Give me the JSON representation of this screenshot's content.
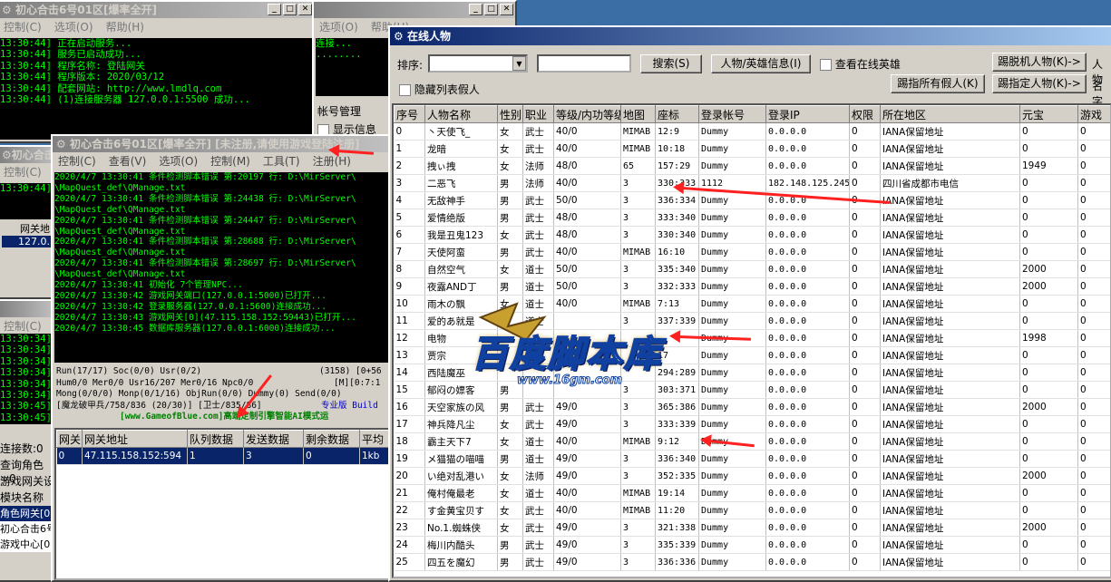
{
  "desk_color": "#3a6ea5",
  "win_login": {
    "title": "初心合击6号01区[爆率全开]",
    "menu": [
      "控制(C)",
      "选项(O)",
      "帮助(H)"
    ],
    "log": [
      "13:30:44] 正在启动服务...",
      "13:30:44] 服务已启动成功...",
      "13:30:44] 程序名称: 登陆网关",
      "13:30:44] 程序版本: 2020/03/12",
      "13:30:44] 配套网站: http://www.lmdlq.com",
      "13:30:44] (1)连接服务器 127.0.0.1:5500 成功..."
    ]
  },
  "win_mid": {
    "menu": [
      "选项(O)",
      "帮助(H)"
    ],
    "log": [
      "连接...",
      "........"
    ],
    "label_account": "帐号管理",
    "check_show": "显示信息"
  },
  "win_left": {
    "title": "初心合击6",
    "menu": [
      "控制(C)",
      "选"
    ],
    "log": [
      "13:30:44]"
    ],
    "col": "网关地",
    "ip": "127.0."
  },
  "win_left2": {
    "menu": "控制(C)",
    "log": [
      "13:30:34]",
      "13:30:34]",
      "13:30:34]",
      "13:30:34]",
      "13:30:34]",
      "13:30:34]",
      "13:30:45]",
      "13:30:45]"
    ],
    "conn": "连接数:0",
    "query": "查询角色=0",
    "gateset": "游戏网关设",
    "modname": "模块名称",
    "mods": [
      "角色网关[0",
      "初心合击6号",
      "游戏中心[0"
    ]
  },
  "win_main": {
    "title": "初心合击6号01区[爆率全开] [未注册,请使用游戏登陆注册]",
    "menu": [
      "控制(C)",
      "查看(V)",
      "选项(O)",
      "控制(M)",
      "工具(T)",
      "注册(H)"
    ],
    "log": [
      "2020/4/7 13:30:41 条件检测脚本错误 第:20197 行: D:\\MirServer\\",
      "\\MapQuest_def\\QManage.txt",
      "2020/4/7 13:30:41 条件检测脚本错误 第:24438 行: D:\\MirServer\\",
      "\\MapQuest_def\\QManage.txt",
      "2020/4/7 13:30:41 条件检测脚本错误 第:24447 行: D:\\MirServer\\",
      "\\MapQuest_def\\QManage.txt",
      "2020/4/7 13:30:41 条件检测脚本错误 第:28688 行: D:\\MirServer\\",
      "\\MapQuest_def\\QManage.txt",
      "2020/4/7 13:30:41 条件检测脚本错误 第:28697 行: D:\\MirServer\\",
      "\\MapQuest_def\\QManage.txt",
      "2020/4/7 13:30:41 初始化 7个管理NPC...",
      "2020/4/7 13:30:42 游戏网关端口(127.0.0.1:5000)已打开...",
      "2020/4/7 13:30:42 登录服务器(127.0.0.1:5600)连接成功...",
      "2020/4/7 13:30:43 游戏网关[0](47.115.158.152:59443)已打开...",
      "2020/4/7 13:30:45 数据库服务器(127.0.0.1:6000)连接成功..."
    ],
    "stat1": "Run(17/17) Soc(0/0) Usr(0/2)",
    "stat1r": "(3158) [0+56",
    "stat2": "Hum0/0 Mer0/0 Usr16/207 Mer0/16 Npc0/0",
    "stat2r": "[M][0:7:1",
    "stat3": "Mong(0/0/0) Monp(0/1/16) ObjRun(0/0) Dummy(0) Send(0/0)",
    "stat4": "[魔龙破甲兵/758/836 (20/30)]  [卫士/835/86]",
    "stat4r": "专业版 Build",
    "banner": "[www.GameofBlue.com]高端定制引擎智能AI模式运",
    "gate_cols": [
      "网关",
      "网关地址",
      "队列数据",
      "发送数据",
      "剩余数据",
      "平均"
    ],
    "gate_row": [
      "0",
      "47.115.158.152:594",
      "1",
      "3",
      "0",
      "1kb"
    ]
  },
  "online": {
    "title": "在线人物",
    "sort_label": "排序:",
    "btn_search": "搜索(S)",
    "btn_info": "人物/英雄信息(I)",
    "chk_hero": "查看在线英雄",
    "btn_kick_off": "踢脱机人物(K)->",
    "btn_person": "人物",
    "chk_hide": "隐藏列表假人",
    "btn_kick_all": "踢指所有假人(K)",
    "btn_kick_sel": "踢指定人物(K)->",
    "btn_name": "名字",
    "cols": [
      "序号",
      "人物名称",
      "性别",
      "职业",
      "等级/内功等级",
      "地图",
      "座标",
      "登录帐号",
      "登录IP",
      "权限",
      "所在地区",
      "元宝",
      "游戏"
    ],
    "rows": [
      [
        "0",
        "丶天使飞_",
        "女",
        "武士",
        "40/0",
        "MIMAB",
        "12:9",
        "Dummy",
        "0.0.0.0",
        "0",
        "IANA保留地址",
        "0",
        "0"
      ],
      [
        "1",
        "龙暗",
        "女",
        "武士",
        "40/0",
        "MIMAB",
        "10:18",
        "Dummy",
        "0.0.0.0",
        "0",
        "IANA保留地址",
        "0",
        "0"
      ],
      [
        "2",
        "拽ぃ拽",
        "女",
        "法师",
        "48/0",
        "65",
        "157:29",
        "Dummy",
        "0.0.0.0",
        "0",
        "IANA保留地址",
        "1949",
        "0"
      ],
      [
        "3",
        "二恶飞",
        "男",
        "法师",
        "40/0",
        "3",
        "330:333",
        "1112",
        "182.148.125.245",
        "0",
        "四川省成都市电信",
        "0",
        "0"
      ],
      [
        "4",
        "无敌神手",
        "男",
        "武士",
        "50/0",
        "3",
        "336:334",
        "Dummy",
        "0.0.0.0",
        "0",
        "IANA保留地址",
        "0",
        "0"
      ],
      [
        "5",
        "爱情绝版",
        "男",
        "武士",
        "48/0",
        "3",
        "333:340",
        "Dummy",
        "0.0.0.0",
        "0",
        "IANA保留地址",
        "0",
        "0"
      ],
      [
        "6",
        "我是丑鬼123",
        "女",
        "武士",
        "48/0",
        "3",
        "330:340",
        "Dummy",
        "0.0.0.0",
        "0",
        "IANA保留地址",
        "0",
        "0"
      ],
      [
        "7",
        "天使阿蛮",
        "男",
        "武士",
        "40/0",
        "MIMAB",
        "16:10",
        "Dummy",
        "0.0.0.0",
        "0",
        "IANA保留地址",
        "0",
        "0"
      ],
      [
        "8",
        "自然空气",
        "女",
        "道士",
        "50/0",
        "3",
        "335:340",
        "Dummy",
        "0.0.0.0",
        "0",
        "IANA保留地址",
        "2000",
        "0"
      ],
      [
        "9",
        "夜露AND丁",
        "男",
        "道士",
        "50/0",
        "3",
        "332:333",
        "Dummy",
        "0.0.0.0",
        "0",
        "IANA保留地址",
        "2000",
        "0"
      ],
      [
        "10",
        "雨木の飘",
        "女",
        "道士",
        "40/0",
        "MIMAB",
        "7:13",
        "Dummy",
        "0.0.0.0",
        "0",
        "IANA保留地址",
        "0",
        "0"
      ],
      [
        "11",
        "爱的あ就是",
        "男",
        "道士",
        "",
        "3",
        "337:339",
        "Dummy",
        "0.0.0.0",
        "0",
        "IANA保留地址",
        "0",
        "0"
      ],
      [
        "12",
        "电物",
        "",
        "",
        "",
        "",
        "",
        "Dummy",
        "0.0.0.0",
        "0",
        "IANA保留地址",
        "1998",
        "0"
      ],
      [
        "13",
        "贾宗",
        "",
        "",
        "",
        "",
        "17",
        "Dummy",
        "0.0.0.0",
        "0",
        "IANA保留地址",
        "0",
        "0"
      ],
      [
        "14",
        "西陆魔巫",
        "",
        "",
        "",
        "",
        "294:289",
        "Dummy",
        "0.0.0.0",
        "0",
        "IANA保留地址",
        "0",
        "0"
      ],
      [
        "15",
        "郁闷の嫖客",
        "男",
        "",
        "",
        "3",
        "303:371",
        "Dummy",
        "0.0.0.0",
        "0",
        "IANA保留地址",
        "0",
        "0"
      ],
      [
        "16",
        "天空家族の风",
        "男",
        "武士",
        "49/0",
        "3",
        "365:386",
        "Dummy",
        "0.0.0.0",
        "0",
        "IANA保留地址",
        "2000",
        "0"
      ],
      [
        "17",
        "神兵降凡尘",
        "女",
        "武士",
        "49/0",
        "3",
        "333:339",
        "Dummy",
        "0.0.0.0",
        "0",
        "IANA保留地址",
        "0",
        "0"
      ],
      [
        "18",
        "霸主天下7",
        "女",
        "道士",
        "40/0",
        "MIMAB",
        "9:12",
        "Dummy",
        "0.0.0.0",
        "0",
        "IANA保留地址",
        "0",
        "0"
      ],
      [
        "19",
        "メ猫猫の喵喵",
        "男",
        "道士",
        "49/0",
        "3",
        "336:340",
        "Dummy",
        "0.0.0.0",
        "0",
        "IANA保留地址",
        "0",
        "0"
      ],
      [
        "20",
        "い绝对乱港い",
        "女",
        "法师",
        "49/0",
        "3",
        "352:335",
        "Dummy",
        "0.0.0.0",
        "0",
        "IANA保留地址",
        "2000",
        "0"
      ],
      [
        "21",
        "俺村俺最老",
        "女",
        "道士",
        "40/0",
        "MIMAB",
        "19:14",
        "Dummy",
        "0.0.0.0",
        "0",
        "IANA保留地址",
        "0",
        "0"
      ],
      [
        "22",
        "す金黄宝贝す",
        "女",
        "武士",
        "40/0",
        "MIMAB",
        "11:20",
        "Dummy",
        "0.0.0.0",
        "0",
        "IANA保留地址",
        "0",
        "0"
      ],
      [
        "23",
        "No.1.蜘蛛侠",
        "女",
        "武士",
        "49/0",
        "3",
        "321:338",
        "Dummy",
        "0.0.0.0",
        "0",
        "IANA保留地址",
        "2000",
        "0"
      ],
      [
        "24",
        "梅川内酷头",
        "男",
        "武士",
        "49/0",
        "3",
        "335:339",
        "Dummy",
        "0.0.0.0",
        "0",
        "IANA保留地址",
        "0",
        "0"
      ],
      [
        "25",
        "四五を魔幻",
        "男",
        "武士",
        "49/0",
        "3",
        "336:336",
        "Dummy",
        "0.0.0.0",
        "0",
        "IANA保留地址",
        "0",
        "0"
      ]
    ]
  },
  "watermark": {
    "title": "百度脚本库",
    "url": "www.16gm.com"
  }
}
